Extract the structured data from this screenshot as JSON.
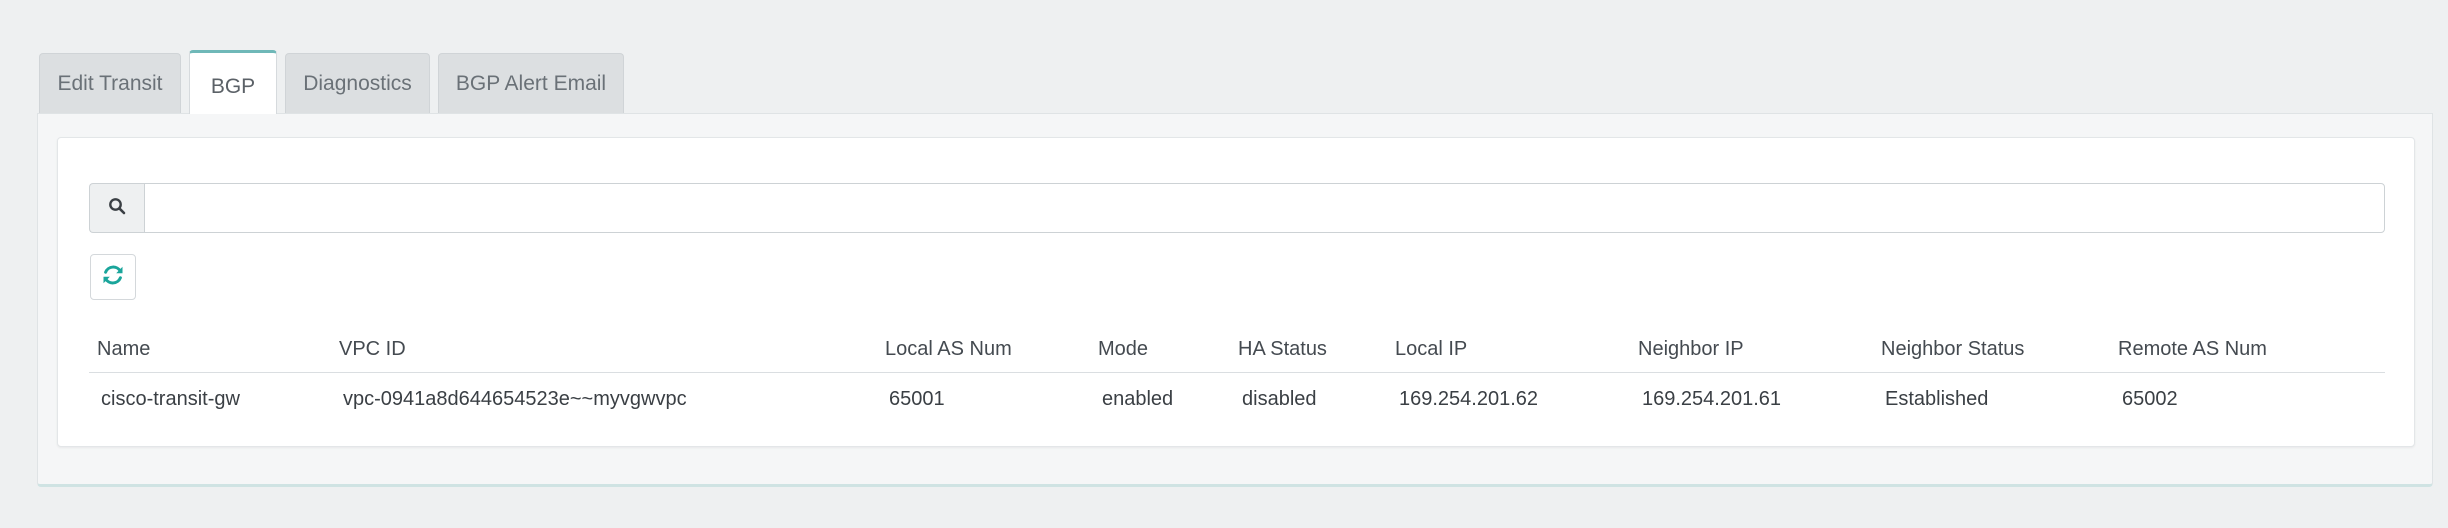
{
  "tabs": [
    {
      "label": "Edit Transit",
      "active": false
    },
    {
      "label": "BGP",
      "active": true
    },
    {
      "label": "Diagnostics",
      "active": false
    },
    {
      "label": "BGP Alert Email",
      "active": false
    }
  ],
  "search": {
    "icon": "search-icon",
    "value": "",
    "placeholder": ""
  },
  "refresh": {
    "icon": "refresh-icon",
    "color": "#1aa59b"
  },
  "table": {
    "headers": {
      "name": "Name",
      "vpc_id": "VPC ID",
      "local_as": "Local AS Num",
      "mode": "Mode",
      "ha_status": "HA Status",
      "local_ip": "Local IP",
      "neighbor_ip": "Neighbor IP",
      "neighbor_status": "Neighbor Status",
      "remote_as": "Remote AS Num"
    },
    "rows": [
      {
        "name": "cisco-transit-gw",
        "vpc_id": "vpc-0941a8d644654523e~~myvgwvpc",
        "local_as": "65001",
        "mode": "enabled",
        "ha_status": "disabled",
        "local_ip": "169.254.201.62",
        "neighbor_ip": "169.254.201.61",
        "neighbor_status": "Established",
        "remote_as": "65002"
      }
    ]
  },
  "colors": {
    "accent": "#6fb8b8",
    "page_bg": "#eef0f1"
  }
}
